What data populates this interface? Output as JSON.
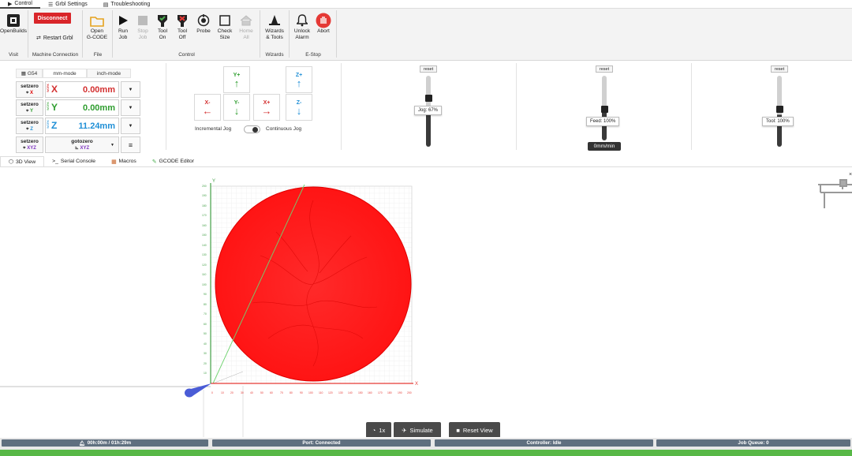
{
  "top_tabs": [
    {
      "label": "Control",
      "icon": "play-icon"
    },
    {
      "label": "Grbl Settings",
      "icon": "list-icon"
    },
    {
      "label": "Troubleshooting",
      "icon": "document-icon"
    }
  ],
  "ribbon": {
    "openbuilds_label": "OpenBuilds",
    "disconnect_label": "Disconnect",
    "restart_label": "Restart Grbl",
    "open_gcode_label": [
      "Open",
      "G-CODE"
    ],
    "run_job_label": [
      "Run",
      "Job"
    ],
    "stop_job_label": [
      "Stop",
      "Job"
    ],
    "tool_on_label": [
      "Tool",
      "On"
    ],
    "tool_off_label": [
      "Tool",
      "Off"
    ],
    "probe_label": "Probe",
    "check_size_label": [
      "Check",
      "Size"
    ],
    "home_all_label": [
      "Home",
      "All"
    ],
    "wizards_label": [
      "Wizards",
      "& Tools"
    ],
    "unlock_label": [
      "Unlock",
      "Alarm"
    ],
    "abort_label": "Abort",
    "groups": {
      "visit": "Visit",
      "machine_connection": "Machine Connection",
      "file": "File",
      "control": "Control",
      "wizards": "Wizards",
      "estop": "E-Stop"
    }
  },
  "dro": {
    "tabs": [
      "G54",
      "mm-mode",
      "inch-mode"
    ],
    "setzero_label": "setzero",
    "gotozero_label": "gotozero",
    "work_label": "WORK",
    "axes": [
      {
        "axis": "X",
        "value": "0.00mm",
        "color": "#d32f2f"
      },
      {
        "axis": "Y",
        "value": "0.00mm",
        "color": "#2e9d2e"
      },
      {
        "axis": "Z",
        "value": "11.24mm",
        "color": "#1f8fd6"
      }
    ],
    "xyz_label": "XYZ"
  },
  "jog": {
    "y_plus": "Y+",
    "y_minus": "Y-",
    "x_plus": "X+",
    "x_minus": "X-",
    "z_plus": "Z+",
    "z_minus": "Z-",
    "incremental_label": "Incremental Jog",
    "continuous_label": "Continuous Jog"
  },
  "overrides": {
    "reset_label": "reset",
    "jog_tip": "Jog: 67%",
    "feed_tip": "Feed: 100%",
    "tool_tip": "Tool: 100%",
    "speed_readout": "0mm/min"
  },
  "view_tabs": [
    {
      "label": "3D View",
      "icon": "cube-icon"
    },
    {
      "label": "Serial Console",
      "icon": "terminal-icon"
    },
    {
      "label": "Macros",
      "icon": "grid-icon"
    },
    {
      "label": "GCODE Editor",
      "icon": "edit-icon"
    }
  ],
  "viewer": {
    "speed_btn": "1x",
    "simulate_btn": "Simulate",
    "reset_view_btn": "Reset View",
    "axis_x": "X",
    "axis_y": "Y",
    "job_color": "#ff1a1a"
  },
  "status": {
    "time": "00h:00m / 01h:29m",
    "port": "Port: Connected",
    "controller": "Controller: Idle",
    "queue": "Job Queue: 0"
  },
  "colors": {
    "disconnect": "#d9262a",
    "status_bg": "#5f6f7f",
    "jog_green": "#2e9d2e",
    "jog_red": "#d32f2f",
    "jog_blue": "#1f8fd6"
  }
}
